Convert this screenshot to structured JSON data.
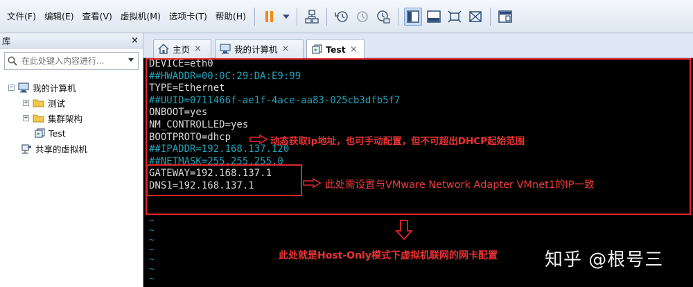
{
  "menu": {
    "items": [
      "文件(F)",
      "编辑(E)",
      "查看(V)",
      "虚拟机(M)",
      "选项卡(T)",
      "帮助(H)"
    ]
  },
  "toolbar": {
    "icons": [
      "pause-icon",
      "dropdown-icon",
      "network-icon",
      "snapshot-take-icon",
      "snapshot-revert-icon",
      "snapshot-manager-icon",
      "library-view-icon",
      "console-view-icon",
      "fullscreen-icon",
      "unity-icon",
      "thumbnail-icon"
    ]
  },
  "library": {
    "title": "库",
    "close": "×",
    "search_placeholder": "在此处键入内容进行...",
    "tree": {
      "root": "我的计算机",
      "items": [
        "测试",
        "集群架构",
        "Test"
      ],
      "shared": "共享的虚拟机"
    }
  },
  "tabs": [
    {
      "label": "主页",
      "close": "×"
    },
    {
      "label": "我的计算机",
      "close": "×"
    },
    {
      "label": "Test",
      "close": "×"
    }
  ],
  "console": {
    "lines": [
      {
        "text": "DEVICE=eth0",
        "color": "#d9d9d9"
      },
      {
        "text": "##HWADDR=00:0C:29:DA:E9:99",
        "color": "#23a1b5"
      },
      {
        "text": "TYPE=Ethernet",
        "color": "#d9d9d9"
      },
      {
        "text": "##UUID=0711466f-ae1f-4ace-aa83-025cb3dfb5f7",
        "color": "#23a1b5"
      },
      {
        "text": "ONBOOT=yes",
        "color": "#d9d9d9"
      },
      {
        "text": "NM_CONTROLLED=yes",
        "color": "#d9d9d9"
      },
      {
        "text": "BOOTPROTO=dhcp",
        "color": "#d9d9d9"
      },
      {
        "text": "##IPADDR=192.168.137.120",
        "color": "#23a1b5"
      },
      {
        "text": "##NETMASK=255.255.255.0",
        "color": "#23a1b5"
      },
      {
        "text": "GATEWAY=192.168.137.1",
        "color": "#d9d9d9"
      },
      {
        "text": "DNS1=192.168.137.1",
        "color": "#d9d9d9"
      }
    ],
    "tilde": "~"
  },
  "annotations": {
    "dhcp_note": "动态获取ip地址，也可手动配置，但不可超出DHCP起始范围",
    "gateway_note": "此处需设置与VMware Network Adapter VMnet1的IP一致",
    "summary_note": "此处就是Host-Only模式下虚拟机联网的网卡配置"
  },
  "watermark": "知乎 @根号三",
  "colors": {
    "annotation_red": "#e0252b",
    "console_bg": "#000000",
    "comment_cyan": "#23a1b5"
  }
}
